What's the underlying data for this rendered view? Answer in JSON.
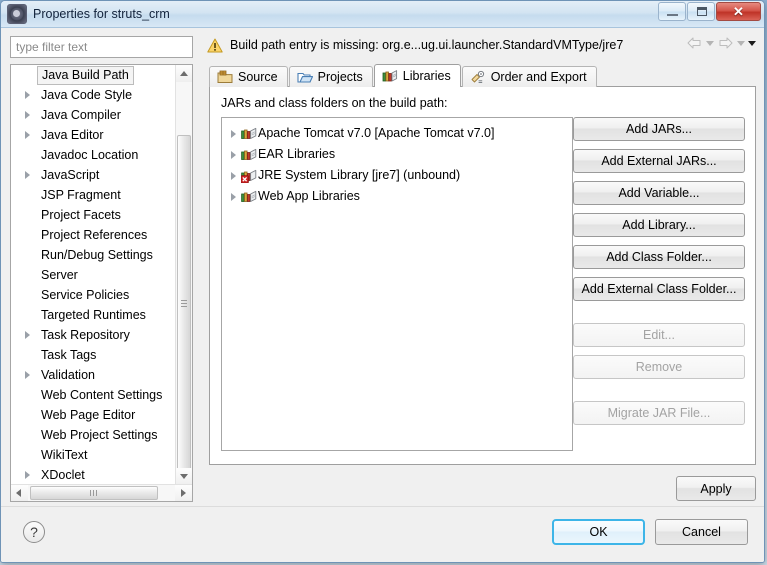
{
  "window": {
    "title": "Properties for struts_crm",
    "icon": "eclipse-properties-icon",
    "buttons": {
      "minimize": "minimize-button",
      "maximize": "maximize-button",
      "close": "close-button"
    }
  },
  "filter": {
    "placeholder": "type filter text",
    "value": ""
  },
  "sidebar": {
    "items": [
      {
        "label": "Java Build Path",
        "expandable": false,
        "selected": true
      },
      {
        "label": "Java Code Style",
        "expandable": true,
        "selected": false
      },
      {
        "label": "Java Compiler",
        "expandable": true,
        "selected": false
      },
      {
        "label": "Java Editor",
        "expandable": true,
        "selected": false
      },
      {
        "label": "Javadoc Location",
        "expandable": false,
        "selected": false
      },
      {
        "label": "JavaScript",
        "expandable": true,
        "selected": false
      },
      {
        "label": "JSP Fragment",
        "expandable": false,
        "selected": false
      },
      {
        "label": "Project Facets",
        "expandable": false,
        "selected": false
      },
      {
        "label": "Project References",
        "expandable": false,
        "selected": false
      },
      {
        "label": "Run/Debug Settings",
        "expandable": false,
        "selected": false
      },
      {
        "label": "Server",
        "expandable": false,
        "selected": false
      },
      {
        "label": "Service Policies",
        "expandable": false,
        "selected": false
      },
      {
        "label": "Targeted Runtimes",
        "expandable": false,
        "selected": false
      },
      {
        "label": "Task Repository",
        "expandable": true,
        "selected": false
      },
      {
        "label": "Task Tags",
        "expandable": false,
        "selected": false
      },
      {
        "label": "Validation",
        "expandable": true,
        "selected": false
      },
      {
        "label": "Web Content Settings",
        "expandable": false,
        "selected": false
      },
      {
        "label": "Web Page Editor",
        "expandable": false,
        "selected": false
      },
      {
        "label": "Web Project Settings",
        "expandable": false,
        "selected": false
      },
      {
        "label": "WikiText",
        "expandable": false,
        "selected": false
      },
      {
        "label": "XDoclet",
        "expandable": true,
        "selected": false
      }
    ]
  },
  "message": {
    "icon": "warning-icon",
    "text": "Build path entry is missing: org.e...ug.ui.launcher.StandardVMType/jre7"
  },
  "navigation": {
    "back": "back-arrow-icon",
    "back_menu": "back-dropdown-icon",
    "forward": "forward-arrow-icon",
    "forward_menu": "forward-dropdown-icon",
    "menu": "view-menu-icon"
  },
  "tabs": [
    {
      "label": "Source",
      "icon": "source-folder-icon",
      "active": false
    },
    {
      "label": "Projects",
      "icon": "projects-folder-icon",
      "active": false
    },
    {
      "label": "Libraries",
      "icon": "libraries-books-icon",
      "active": true
    },
    {
      "label": "Order and Export",
      "icon": "order-export-icon",
      "active": false
    }
  ],
  "main": {
    "list_label": "JARs and class folders on the build path:",
    "entries": [
      {
        "label": "Apache Tomcat v7.0 [Apache Tomcat v7.0]",
        "icon": "library-icon",
        "error": false
      },
      {
        "label": "EAR Libraries",
        "icon": "library-icon",
        "error": false
      },
      {
        "label": "JRE System Library [jre7] (unbound)",
        "icon": "library-error-icon",
        "error": true
      },
      {
        "label": "Web App Libraries",
        "icon": "library-icon",
        "error": false
      }
    ],
    "side_buttons": [
      {
        "label": "Add JARs...",
        "enabled": true
      },
      {
        "label": "Add External JARs...",
        "enabled": true
      },
      {
        "label": "Add Variable...",
        "enabled": true
      },
      {
        "label": "Add Library...",
        "enabled": true
      },
      {
        "label": "Add Class Folder...",
        "enabled": true
      },
      {
        "label": "Add External Class Folder...",
        "enabled": true
      },
      {
        "label": "Edit...",
        "enabled": false
      },
      {
        "label": "Remove",
        "enabled": false
      },
      {
        "label": "Migrate JAR File...",
        "enabled": false
      }
    ],
    "apply_label": "Apply"
  },
  "footer": {
    "help_icon": "help-icon",
    "help_glyph": "?",
    "ok_label": "OK",
    "cancel_label": "Cancel"
  },
  "colors": {
    "accent": "#3db5e8",
    "title_bar": "#d3e4f2",
    "close_button": "#bf3327",
    "error_badge": "#cc2222",
    "warning": "#f0b400"
  }
}
